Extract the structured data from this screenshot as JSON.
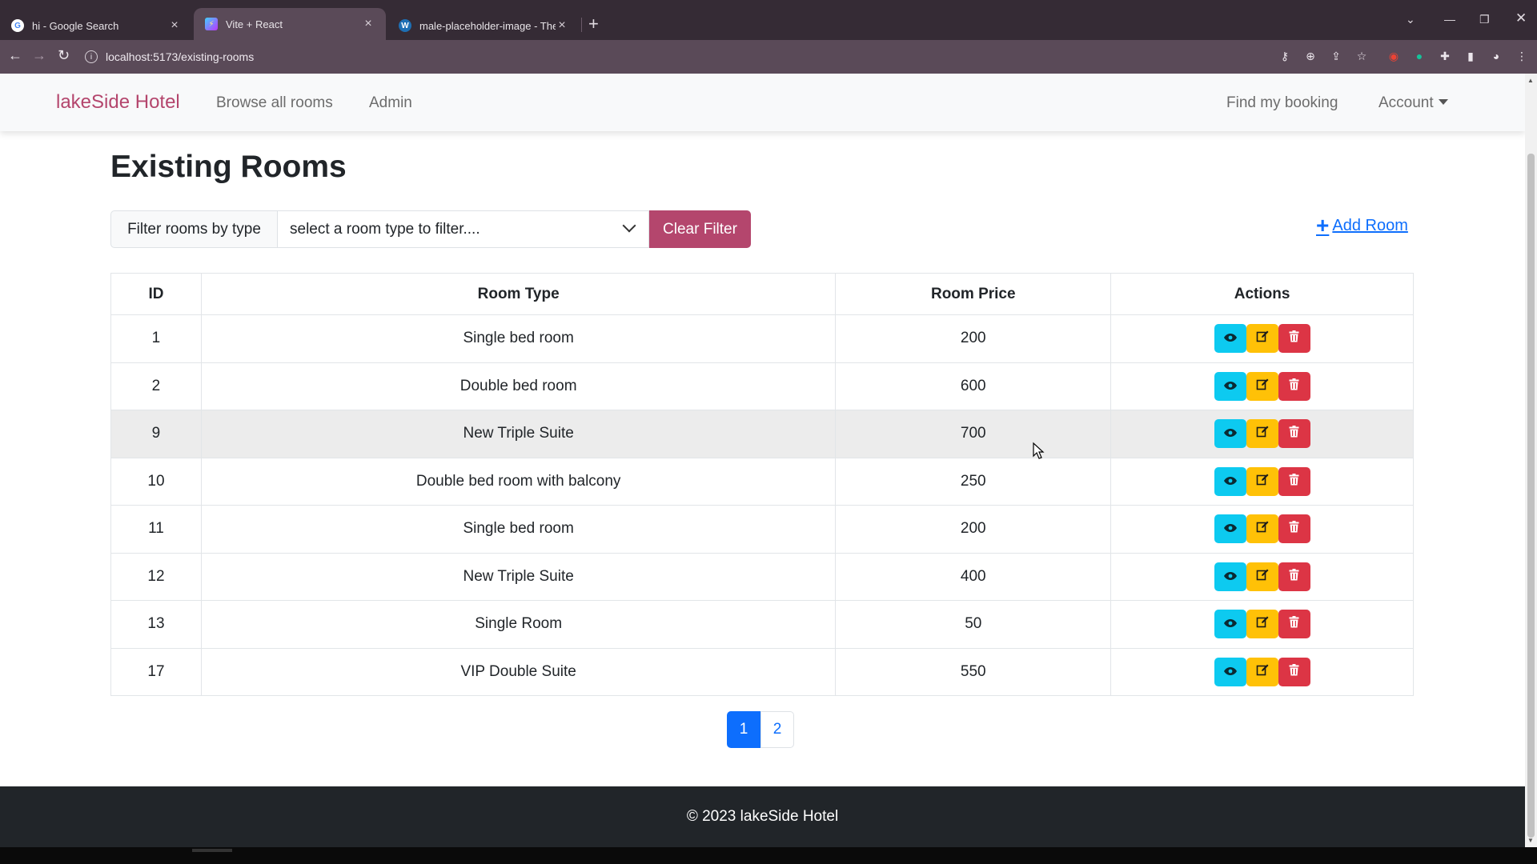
{
  "browser": {
    "tabs": [
      {
        "title": "hi - Google Search",
        "favicon": "google-icon"
      },
      {
        "title": "Vite + React",
        "favicon": "vite-icon"
      },
      {
        "title": "male-placeholder-image - The N",
        "favicon": "wordpress-icon"
      }
    ],
    "new_tab": "+",
    "url": "localhost:5173/existing-rooms"
  },
  "navbar": {
    "brand": "lakeSide Hotel",
    "links": [
      "Browse all rooms",
      "Admin"
    ],
    "right_links": [
      "Find my booking"
    ],
    "account": "Account"
  },
  "main": {
    "title": "Existing Rooms",
    "filter_label": "Filter rooms by type",
    "filter_select_value": "select a room type to filter....",
    "clear_filter": "Clear Filter",
    "add_room": "Add Room"
  },
  "table": {
    "headers": [
      "ID",
      "Room Type",
      "Room Price",
      "Actions"
    ],
    "rows": [
      {
        "id": "1",
        "type": "Single bed room",
        "price": "200"
      },
      {
        "id": "2",
        "type": "Double bed room",
        "price": "600"
      },
      {
        "id": "9",
        "type": "New Triple Suite",
        "price": "700"
      },
      {
        "id": "10",
        "type": "Double bed room with balcony",
        "price": "250"
      },
      {
        "id": "11",
        "type": "Single bed room",
        "price": "200"
      },
      {
        "id": "12",
        "type": "New Triple Suite",
        "price": "400"
      },
      {
        "id": "13",
        "type": "Single Room",
        "price": "50"
      },
      {
        "id": "17",
        "type": "VIP Double Suite",
        "price": "550"
      }
    ]
  },
  "pagination": {
    "pages": [
      "1",
      "2"
    ],
    "current": "1"
  },
  "footer": {
    "text": "© 2023 lakeSide Hotel"
  },
  "colors": {
    "brand": "#b4466d",
    "primary": "#0d6efd",
    "info": "#0dcaf0",
    "warning": "#ffc107",
    "danger": "#dc3545",
    "footer_bg": "#212529"
  }
}
